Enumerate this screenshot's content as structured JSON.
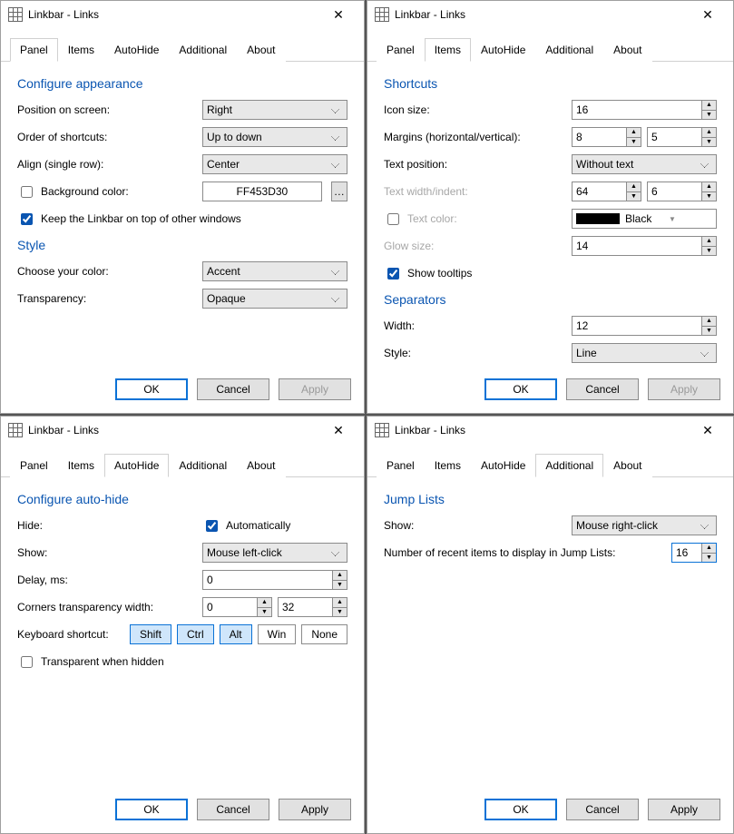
{
  "window_title": "Linkbar - Links",
  "tabs": {
    "panel": "Panel",
    "items": "Items",
    "autohide": "AutoHide",
    "additional": "Additional",
    "about": "About"
  },
  "buttons": {
    "ok": "OK",
    "cancel": "Cancel",
    "apply": "Apply"
  },
  "panel": {
    "sect1": "Configure appearance",
    "position_lbl": "Position on screen:",
    "position_val": "Right",
    "order_lbl": "Order of shortcuts:",
    "order_val": "Up to down",
    "align_lbl": "Align (single row):",
    "align_val": "Center",
    "bg_lbl": "Background color:",
    "bg_val": "FF453D30",
    "ontop_lbl": "Keep the Linkbar on top of other windows",
    "sect2": "Style",
    "color_lbl": "Choose your color:",
    "color_val": "Accent",
    "transp_lbl": "Transparency:",
    "transp_val": "Opaque"
  },
  "items": {
    "sect1": "Shortcuts",
    "icon_lbl": "Icon size:",
    "icon_val": "16",
    "margins_lbl": "Margins (horizontal/vertical):",
    "margins_h": "8",
    "margins_v": "5",
    "textpos_lbl": "Text position:",
    "textpos_val": "Without text",
    "textw_lbl": "Text width/indent:",
    "textw_a": "64",
    "textw_b": "6",
    "textcolor_lbl": "Text color:",
    "textcolor_val": "Black",
    "glow_lbl": "Glow size:",
    "glow_val": "14",
    "tooltips_lbl": "Show tooltips",
    "sect2": "Separators",
    "sep_w_lbl": "Width:",
    "sep_w_val": "12",
    "sep_style_lbl": "Style:",
    "sep_style_val": "Line"
  },
  "autohide": {
    "sect1": "Configure auto-hide",
    "hide_lbl": "Hide:",
    "auto_lbl": "Automatically",
    "show_lbl": "Show:",
    "show_val": "Mouse left-click",
    "delay_lbl": "Delay, ms:",
    "delay_val": "0",
    "corners_lbl": "Corners transparency width:",
    "corners_a": "0",
    "corners_b": "32",
    "kbd_lbl": "Keyboard shortcut:",
    "shift": "Shift",
    "ctrl": "Ctrl",
    "alt": "Alt",
    "win": "Win",
    "none": "None",
    "transparent_lbl": "Transparent when hidden"
  },
  "additional": {
    "sect1": "Jump Lists",
    "show_lbl": "Show:",
    "show_val": "Mouse right-click",
    "recent_lbl": "Number of recent items to display in Jump Lists:",
    "recent_val": "16"
  }
}
